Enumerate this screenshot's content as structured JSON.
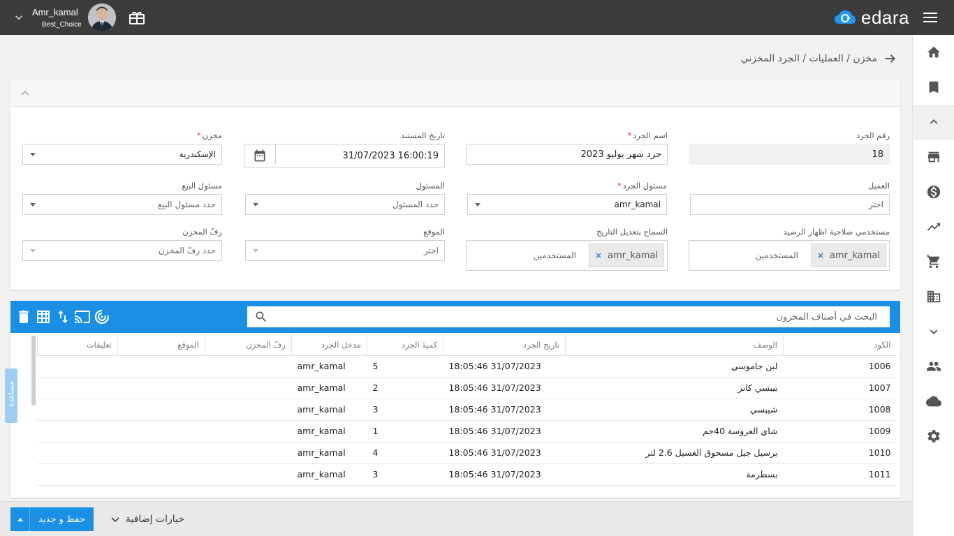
{
  "topbar": {
    "user_name": "Amr_kamal",
    "company": "Best_Choice",
    "logo_text": "edara"
  },
  "breadcrumb": "مخزن / العمليات / الجرد المخزني",
  "form": {
    "count_no": {
      "label": "رقم الجرد",
      "value": "18"
    },
    "count_name": {
      "label": "اسم الجرد",
      "value": "جرد شهر يوليو 2023"
    },
    "doc_date": {
      "label": "تاريخ المستند",
      "value": "31/07/2023 16:00:19"
    },
    "warehouse": {
      "label": "مخزن",
      "value": "الإسكندرية"
    },
    "customer": {
      "label": "العميل",
      "placeholder": "اختر"
    },
    "count_responsible": {
      "label": "مسئول الجرد",
      "value": "amr_kamal"
    },
    "responsible": {
      "label": "المسئول",
      "placeholder": "حدد المسئول"
    },
    "sales_responsible": {
      "label": "مسئول البيع",
      "placeholder": "حدد مسئول البيع"
    },
    "balance_users": {
      "label": "مستخدمي صلاحية اظهار الرصيد",
      "tag": "amr_kamal",
      "placeholder": "المستخدمين"
    },
    "date_edit_users": {
      "label": "السماح بتعديل التاريخ",
      "tag": "amr_kamal",
      "placeholder": "المستخدمين"
    },
    "location": {
      "label": "الموقع",
      "placeholder": "اختر"
    },
    "shelf": {
      "label": "رفّ المخزن",
      "placeholder": "حدد رفّ المخزن"
    }
  },
  "grid": {
    "search_placeholder": "البحث في أصناف المخزون",
    "columns": [
      "الكود",
      "الوصف",
      "تاريخ الجرد",
      "كمية الجرد",
      "مدخل الجرد",
      "رفّ المخزن",
      "الموقع",
      "تعليقات"
    ],
    "rows": [
      [
        "1006",
        "لبن جاموسي",
        "31/07/2023 18:05:46",
        "5",
        "amr_kamal",
        "",
        "",
        ""
      ],
      [
        "1007",
        "بيبسي كانز",
        "31/07/2023 18:05:46",
        "2",
        "amr_kamal",
        "",
        "",
        ""
      ],
      [
        "1008",
        "شيبسي",
        "31/07/2023 18:05:46",
        "3",
        "amr_kamal",
        "",
        "",
        ""
      ],
      [
        "1009",
        "شاي العروسة 40جم",
        "31/07/2023 18:05:46",
        "1",
        "amr_kamal",
        "",
        "",
        ""
      ],
      [
        "1010",
        "برسيل جيل مسحوق الغسيل 2.6 لتر",
        "31/07/2023 18:05:46",
        "4",
        "amr_kamal",
        "",
        "",
        ""
      ],
      [
        "1011",
        "بسطرمة",
        "31/07/2023 18:05:46",
        "3",
        "amr_kamal",
        "",
        "",
        ""
      ]
    ]
  },
  "help_tab": "مساعدة",
  "bottom": {
    "save_label": "حفظ و جديد",
    "more_label": "خيارات إضافية"
  },
  "colors": {
    "topbar": "#3c3c3c",
    "accent": "#1a8fe3"
  }
}
